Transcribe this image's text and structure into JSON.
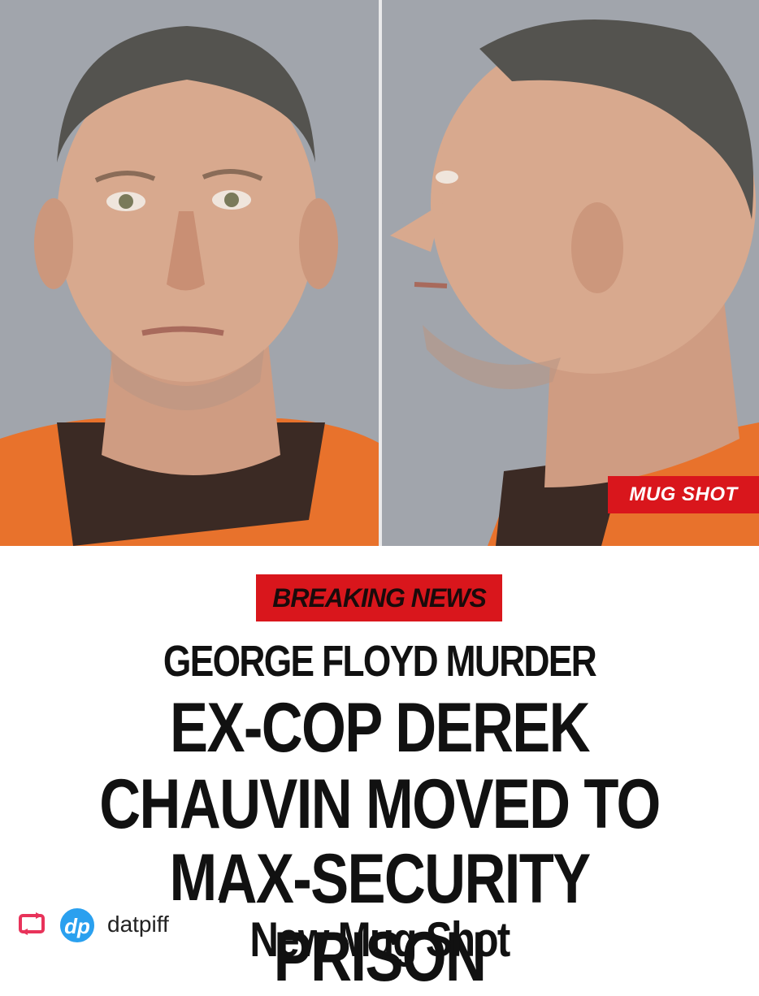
{
  "photo": {
    "badge": "MUG SHOT"
  },
  "caption": {
    "breaking": "BREAKING NEWS",
    "lines": [
      "GEORGE FLOYD MURDER",
      "EX-COP DEREK",
      "CHAUVIN MOVED TO",
      "MAX-SECURITY PRISON",
      "New Mug Shot"
    ]
  },
  "repost": {
    "icon": "repost-icon",
    "avatar_text": "dp",
    "username": "datpiff"
  },
  "colors": {
    "accent_red": "#d9161c",
    "shirt_orange": "#e8722c",
    "repost_pink": "#e8335a",
    "avatar_blue": "#2aa0ef"
  }
}
